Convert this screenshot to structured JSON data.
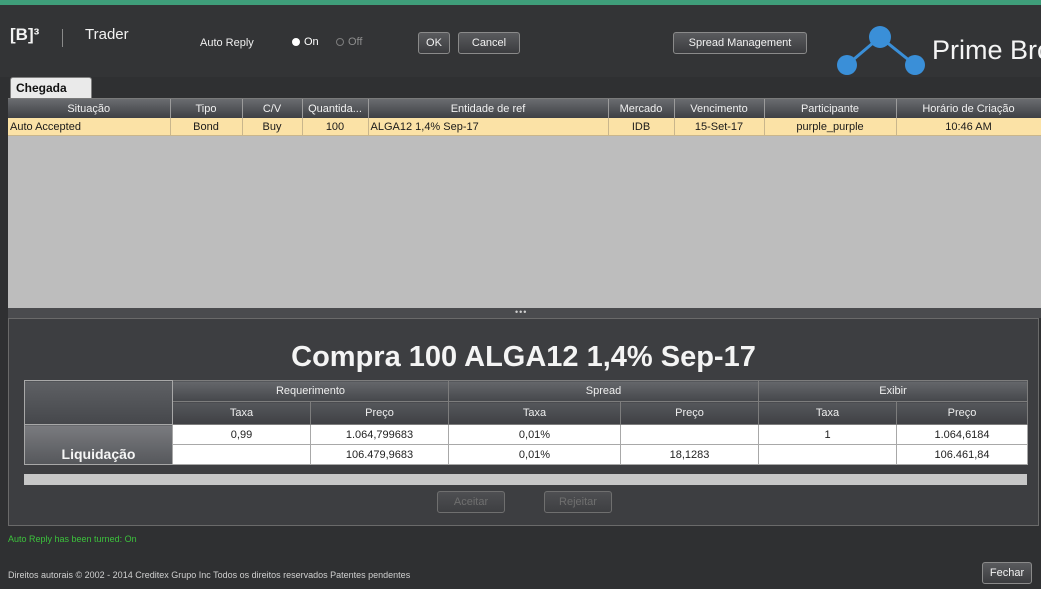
{
  "header": {
    "brand": "[B]³",
    "app_title": "Trader",
    "auto_reply_label": "Auto Reply",
    "radio_on": "On",
    "radio_off": "Off",
    "ok_label": "OK",
    "cancel_label": "Cancel",
    "spread_management_label": "Spread Management",
    "logo_text": "Prime Brc"
  },
  "tab": {
    "label": "Chegada"
  },
  "grid": {
    "columns": [
      "Situação",
      "Tipo",
      "C/V",
      "Quantida...",
      "Entidade de ref",
      "Mercado",
      "Vencimento",
      "Participante",
      "Horário de Criação"
    ],
    "rows": [
      [
        "Auto Accepted",
        "Bond",
        "Buy",
        "100",
        "ALGA12 1,4% Sep-17",
        "IDB",
        "15-Set-17",
        "purple_purple",
        "10:46 AM"
      ]
    ]
  },
  "splitter": {
    "handle": "•••"
  },
  "detail": {
    "title": "Compra 100 ALGA12 1,4% Sep-17",
    "groups": [
      "Requerimento",
      "Spread",
      "Exibir"
    ],
    "subheaders": [
      "Taxa",
      "Preço",
      "Taxa",
      "Preço",
      "Taxa",
      "Preço"
    ],
    "row_label": "Liquidação",
    "rows": [
      [
        "0,99",
        "1.064,799683",
        "0,01%",
        "",
        "1",
        "1.064,6184"
      ],
      [
        "",
        "106.479,9683",
        "0,01%",
        "18,1283",
        "",
        "106.461,84"
      ]
    ],
    "accept_label": "Aceitar",
    "reject_label": "Rejeitar"
  },
  "footer": {
    "status_message": "Auto Reply has been turned: On",
    "copyright": "Direitos autorais © 2002 - 2014 Creditex Grupo Inc Todos os direitos reservados Patentes pendentes",
    "close_label": "Fechar"
  },
  "colors": {
    "accent_green": "#3f9e7a",
    "logo_blue": "#3a8fd8",
    "row_highlight": "#fbe2a6",
    "status_green": "#3cc23c"
  }
}
